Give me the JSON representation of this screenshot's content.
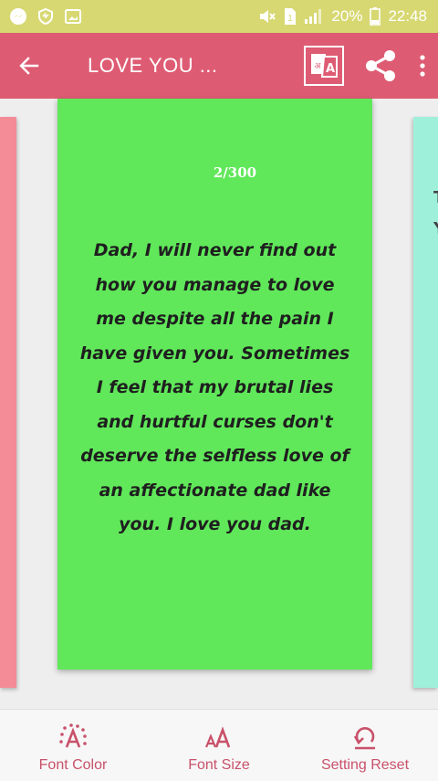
{
  "status_bar": {
    "battery_percent": "20%",
    "time": "22:48",
    "sim_label": "1"
  },
  "app_bar": {
    "title": "LOVE YOU ..."
  },
  "card": {
    "counter": "2/300",
    "lines": [
      "Dad, I will never find out",
      "how you manage to love",
      "me despite all the pain I",
      "have given you. Sometimes",
      "I feel that my brutal lies",
      "and hurtful curses don't",
      "deserve the selfless love of",
      "an affectionate dad like",
      "you. I love you dad."
    ],
    "background": "#60e85a"
  },
  "side_cards": {
    "left_color": "#f38c96",
    "right_color": "#9ff0db",
    "right_peek_chars": [
      "T",
      "Y"
    ]
  },
  "bottom_bar": {
    "items": [
      {
        "label": "Font Color"
      },
      {
        "label": "Font Size"
      },
      {
        "label": "Setting Reset"
      }
    ]
  },
  "colors": {
    "status_bar": "#d7d872",
    "app_bar": "#de5c73",
    "accent": "#c9516a"
  }
}
